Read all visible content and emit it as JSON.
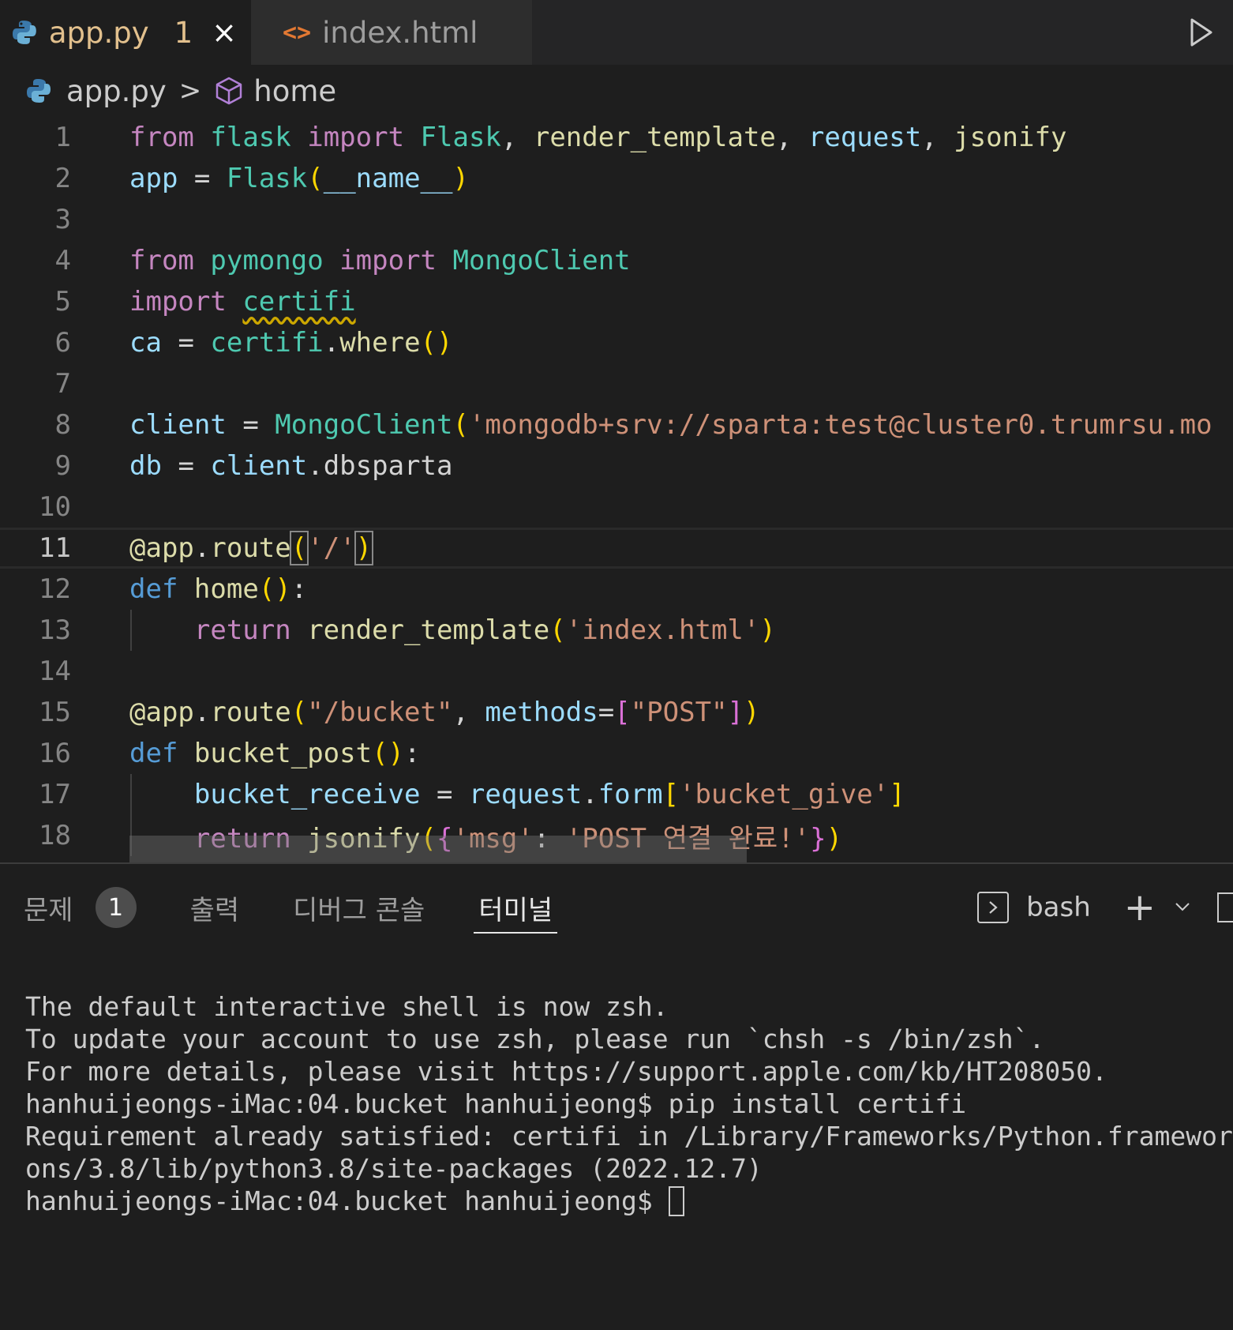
{
  "tabs": [
    {
      "icon": "python-icon",
      "label": "app.py",
      "problems": "1",
      "close": "×",
      "active": true
    },
    {
      "icon": "html-icon",
      "icon_glyph": "<>",
      "label": "index.html",
      "active": false
    }
  ],
  "breadcrumb": {
    "file": "app.py",
    "separator": ">",
    "symbol": "home"
  },
  "editor": {
    "line_numbers": [
      "1",
      "2",
      "3",
      "4",
      "5",
      "6",
      "7",
      "8",
      "9",
      "10",
      "11",
      "12",
      "13",
      "14",
      "15",
      "16",
      "17",
      "18"
    ],
    "current_line": "11"
  },
  "panel": {
    "tabs": [
      {
        "label": "문제",
        "badge": "1"
      },
      {
        "label": "출력"
      },
      {
        "label": "디버그 콘솔"
      },
      {
        "label": "터미널",
        "active": true
      }
    ],
    "shell_name": "bash",
    "add_glyph": "+",
    "dropdown_glyph": "⌵"
  },
  "terminal": {
    "lines": [
      "The default interactive shell is now zsh.",
      "To update your account to use zsh, please run `chsh -s /bin/zsh`.",
      "For more details, please visit https://support.apple.com/kb/HT208050.",
      "hanhuijeongs-iMac:04.bucket hanhuijeong$ pip install certifi",
      "Requirement already satisfied: certifi in /Library/Frameworks/Python.framewor",
      "ons/3.8/lib/python3.8/site-packages (2022.12.7)",
      "hanhuijeongs-iMac:04.bucket hanhuijeong$ "
    ]
  },
  "colors": {
    "background": "#1e1e1e",
    "keyword": "#c586c0",
    "string": "#ce9178",
    "function": "#dcdcaa",
    "module": "#4ec9b0",
    "variable": "#9cdcfe"
  }
}
